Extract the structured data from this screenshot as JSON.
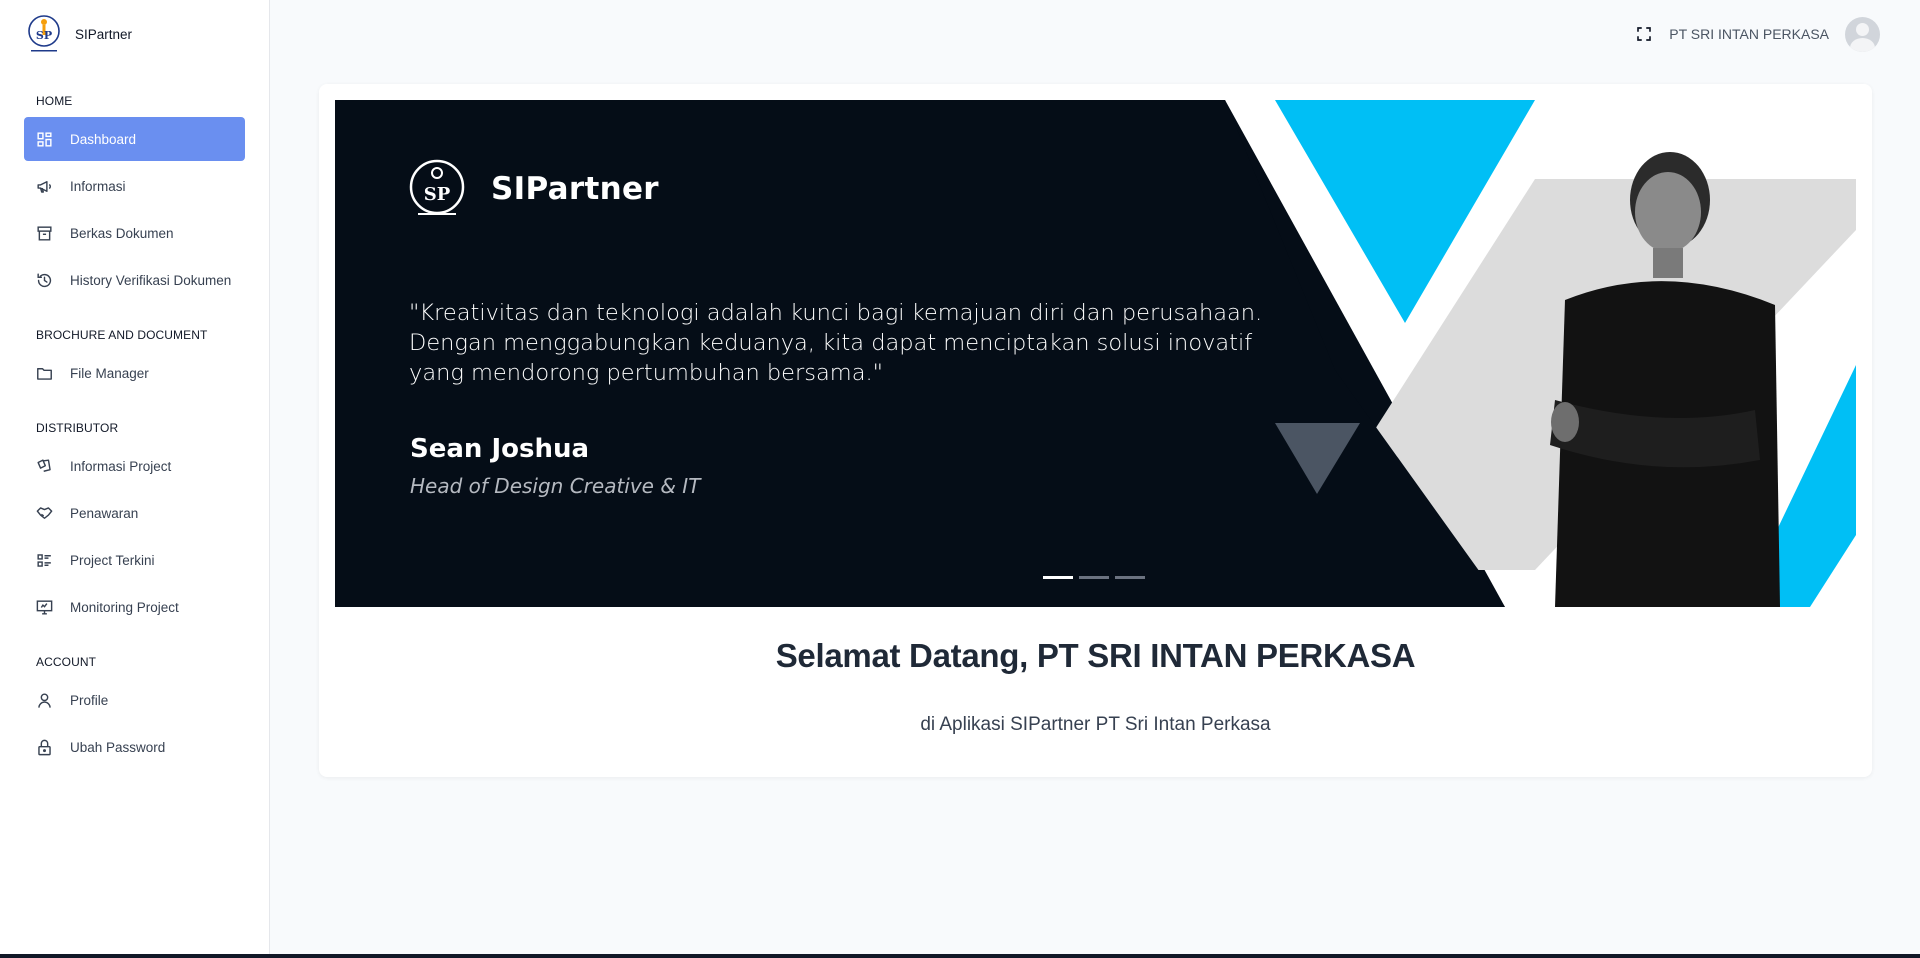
{
  "app": {
    "brand_name": "SIPartner"
  },
  "sidebar": {
    "sections": [
      {
        "title": "HOME",
        "items": [
          {
            "label": "Dashboard",
            "icon": "dashboard-icon",
            "active": true
          },
          {
            "label": "Informasi",
            "icon": "megaphone-icon"
          },
          {
            "label": "Berkas Dokumen",
            "icon": "archive-icon"
          },
          {
            "label": "History Verifikasi Dokumen",
            "icon": "history-icon"
          }
        ]
      },
      {
        "title": "BROCHURE AND DOCUMENT",
        "items": [
          {
            "label": "File Manager",
            "icon": "folder-icon"
          }
        ]
      },
      {
        "title": "DISTRIBUTOR",
        "items": [
          {
            "label": "Informasi Project",
            "icon": "cards-icon"
          },
          {
            "label": "Penawaran",
            "icon": "handshake-icon"
          },
          {
            "label": "Project Terkini",
            "icon": "list-details-icon"
          },
          {
            "label": "Monitoring Project",
            "icon": "monitor-chart-icon"
          }
        ]
      },
      {
        "title": "ACCOUNT",
        "items": [
          {
            "label": "Profile",
            "icon": "user-icon"
          },
          {
            "label": "Ubah Password",
            "icon": "lock-icon"
          }
        ]
      }
    ]
  },
  "header": {
    "company_name": "PT SRI INTAN PERKASA",
    "fullscreen_icon": "fullscreen-icon"
  },
  "banner": {
    "brand": "SIPartner",
    "quote": "\"Kreativitas dan teknologi adalah kunci bagi kemajuan diri dan perusahaan. Dengan menggabungkan keduanya, kita dapat menciptakan solusi inovatif yang mendorong pertumbuhan bersama.\"",
    "person_name": "Sean Joshua",
    "person_title": "Head of Design Creative & IT",
    "slides_total": 3,
    "active_slide": 1,
    "colors": {
      "background": "#050d17",
      "accent": "#00bff5",
      "gray": "#dcdcdc"
    }
  },
  "welcome": {
    "title": "Selamat Datang, PT SRI INTAN PERKASA",
    "subtitle": "di Aplikasi SIPartner PT Sri Intan Perkasa"
  },
  "colors": {
    "active_nav": "#6a8ff0"
  }
}
